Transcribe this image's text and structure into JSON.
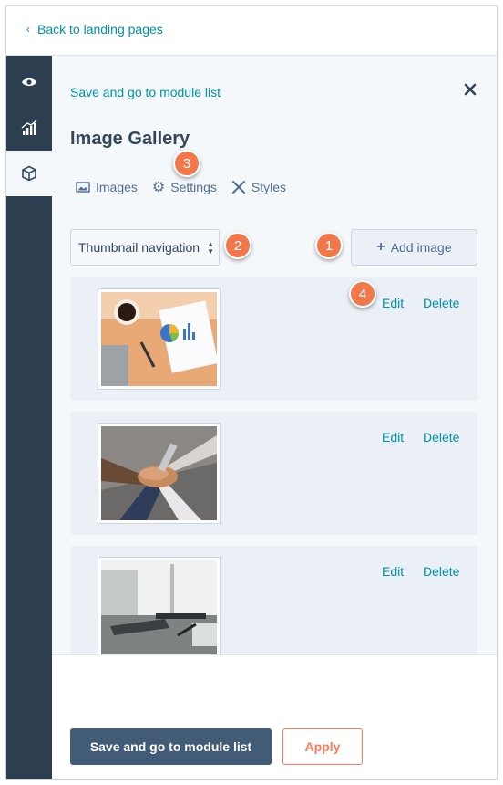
{
  "topbar": {
    "back_label": "Back to landing pages"
  },
  "rail": {
    "items": [
      "eye-icon",
      "chart-icon",
      "module-cube-icon"
    ],
    "active": 2
  },
  "panel": {
    "save_link": "Save and go to module list",
    "title": "Image Gallery",
    "tabs": [
      {
        "label": "Images",
        "icon": "image-icon"
      },
      {
        "label": "Settings",
        "icon": "gear-icon"
      },
      {
        "label": "Styles",
        "icon": "brush-icon"
      }
    ],
    "navigation_select": "Thumbnail navigation",
    "add_image": "Add image",
    "images": [
      {
        "edit": "Edit",
        "delete": "Delete",
        "subject": "desk with coffee and charts"
      },
      {
        "edit": "Edit",
        "delete": "Delete",
        "subject": "team hands stacked"
      },
      {
        "edit": "Edit",
        "delete": "Delete",
        "subject": "office desk with laptop"
      }
    ]
  },
  "footer": {
    "primary": "Save and go to module list",
    "secondary": "Apply"
  },
  "callouts": [
    "1",
    "2",
    "3",
    "4"
  ],
  "colors": {
    "link": "#0091ae",
    "rail": "#2d3e50",
    "accent": "#ff7a59",
    "callout": "#f2784b",
    "primary": "#425b76"
  }
}
